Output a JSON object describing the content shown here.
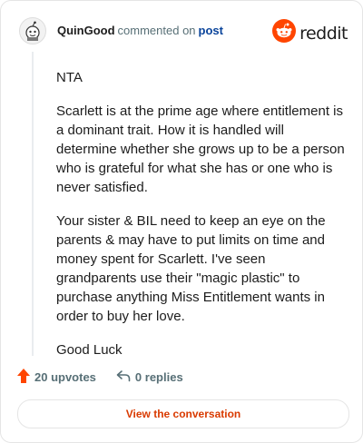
{
  "header": {
    "username": "QuinGood",
    "commented_text": "commented on",
    "post_link": "post",
    "brand_name": "reddit",
    "brand_color": "#ff4500",
    "avatar_icon": "snoo-avatar-icon",
    "logo_icon": "reddit-snoo-icon"
  },
  "comment": {
    "paragraphs": [
      "NTA",
      "Scarlett is at the prime age where entitlement is a dominant trait. How it is handled will determine whether she grows up to be a person who is grateful for what she has or one who is never satisfied.",
      "Your sister & BIL need to keep an eye on the parents & may have to put limits on time and money spent for Scarlett. I've seen grandparents use their \"magic plastic\" to purchase anything Miss Entitlement wants in order to buy her love.",
      "Good Luck"
    ]
  },
  "actions": {
    "upvotes": "20 upvotes",
    "replies": "0 replies",
    "upvote_color": "#ff4500",
    "upvote_icon": "upvote-arrow-icon",
    "reply_icon": "reply-arrow-icon"
  },
  "cta": {
    "label": "View the conversation",
    "color": "#d93a00"
  }
}
